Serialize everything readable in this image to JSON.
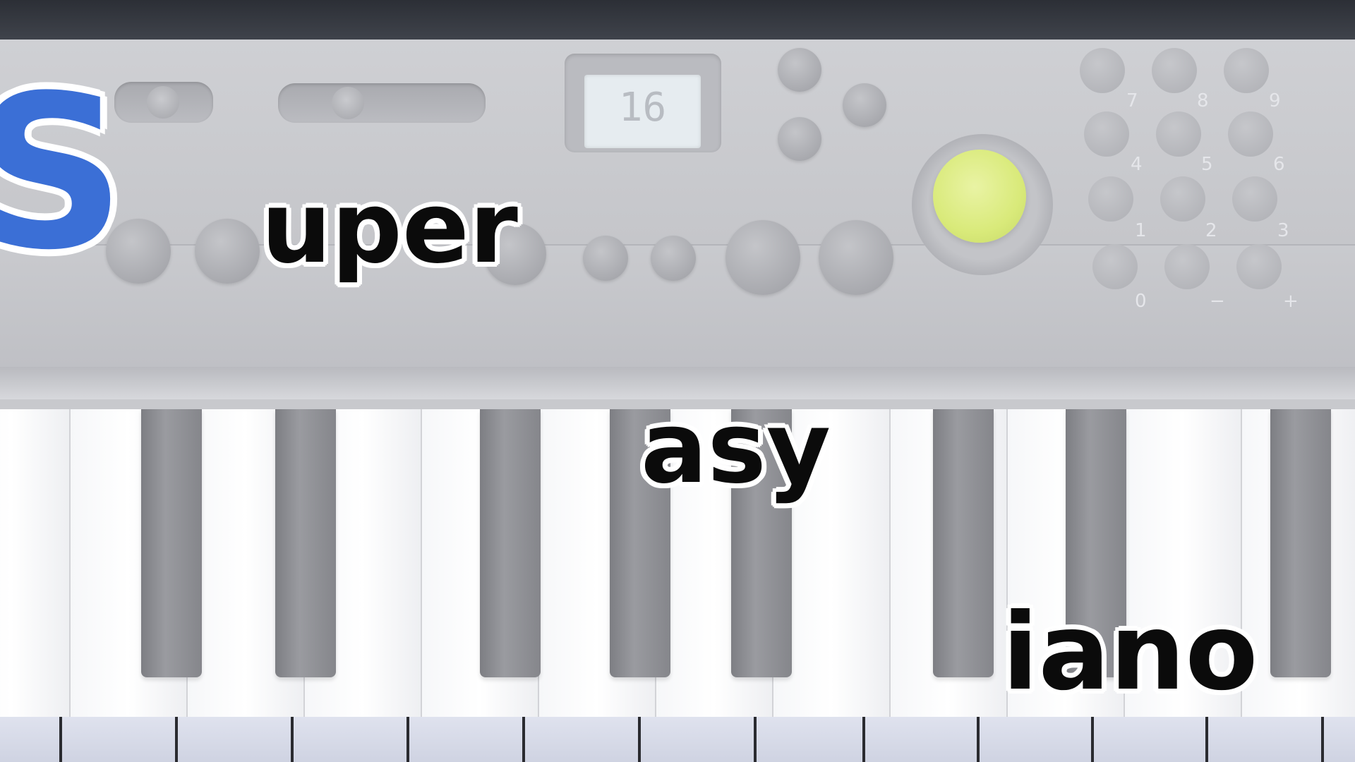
{
  "title": {
    "first_letter": "S",
    "word_1": "uper",
    "word_2": "asy",
    "word_3": "iano"
  },
  "keyboard_panel": {
    "lcd_display": "16",
    "number_pad": [
      "7",
      "8",
      "9",
      "4",
      "5",
      "6",
      "1",
      "2",
      "3",
      "0",
      "−",
      "+"
    ]
  },
  "colors": {
    "logo_blue": "#3b6fd6",
    "text_black": "#0b0b0b",
    "outline_white": "#ffffff",
    "knob_yellow": "#d9ea7a"
  }
}
